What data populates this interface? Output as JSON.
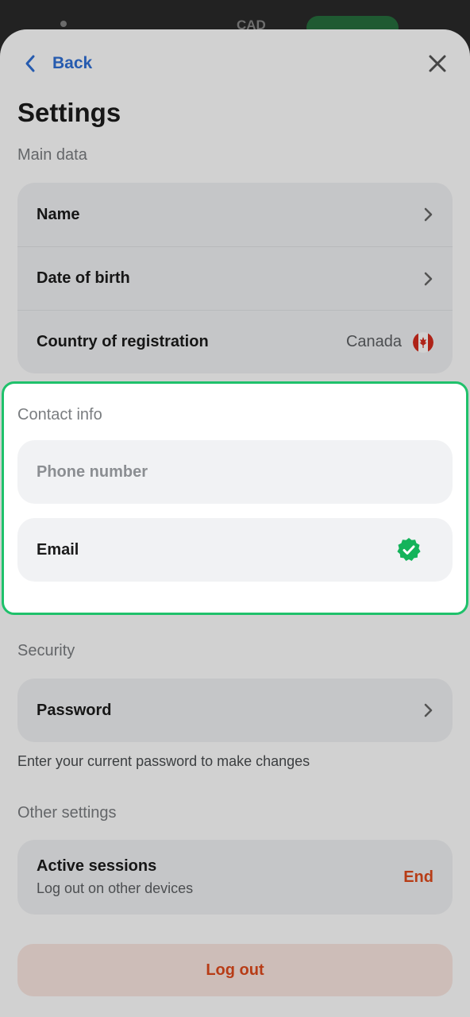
{
  "header": {
    "back_label": "Back",
    "title": "Settings"
  },
  "main_data": {
    "label": "Main data",
    "rows": [
      {
        "label": "Name"
      },
      {
        "label": "Date of birth"
      },
      {
        "label": "Country of registration",
        "value": "Canada",
        "flag_icon": "canada-flag-icon"
      }
    ]
  },
  "contact_info": {
    "label": "Contact info",
    "phone_placeholder": "Phone number",
    "email_label": "Email",
    "email_status_icon": "verified-check-icon"
  },
  "security": {
    "label": "Security",
    "password_label": "Password",
    "hint": "Enter your current password to make changes"
  },
  "other_settings": {
    "label": "Other settings",
    "sessions_title": "Active sessions",
    "sessions_subtitle": "Log out on other devices",
    "end_label": "End"
  },
  "logout_label": "Log out",
  "background": {
    "currency": "CAD"
  },
  "colors": {
    "accent_blue": "#2f6fd6",
    "highlight_green": "#1fc16b",
    "danger": "#e04a1c"
  }
}
